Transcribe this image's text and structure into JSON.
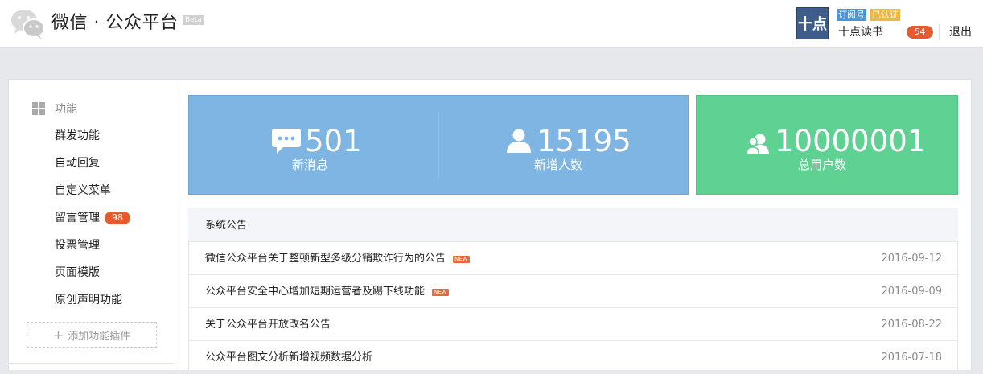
{
  "header": {
    "brand": "微信 · 公众平台",
    "beta": "Beta",
    "account": {
      "avatar_text": "十点",
      "type_tag": "订阅号",
      "verified_tag": "已认证",
      "name": "十点读书",
      "notice_count": "54",
      "logout": "退出"
    }
  },
  "sidebar": {
    "title": "功能",
    "items": [
      {
        "label": "群发功能"
      },
      {
        "label": "自动回复"
      },
      {
        "label": "自定义菜单"
      },
      {
        "label": "留言管理",
        "badge": "98"
      },
      {
        "label": "投票管理"
      },
      {
        "label": "页面模版"
      },
      {
        "label": "原创声明功能"
      }
    ],
    "add_plugin": "添加功能插件"
  },
  "stats": {
    "messages": {
      "value": "501",
      "label": "新消息"
    },
    "new_users": {
      "value": "15195",
      "label": "新增人数"
    },
    "total_users": {
      "value": "10000001",
      "label": "总用户数"
    }
  },
  "announcements": {
    "title": "系统公告",
    "new_tag": "NEW",
    "items": [
      {
        "text": "微信公众平台关于整顿新型多级分销欺诈行为的公告",
        "date": "2016-09-12",
        "is_new": true
      },
      {
        "text": "公众平台安全中心增加短期运营者及踢下线功能",
        "date": "2016-09-09",
        "is_new": true
      },
      {
        "text": "关于公众平台开放改名公告",
        "date": "2016-08-22",
        "is_new": false
      },
      {
        "text": "公众平台图文分析新增视频数据分析",
        "date": "2016-07-18",
        "is_new": false
      }
    ]
  },
  "colors": {
    "blue_panel": "#7eb5e2",
    "green_panel": "#5fd192",
    "badge_red": "#e65b2d",
    "type_tag_blue": "#4b96d8",
    "verified_orange": "#f0b83c"
  },
  "icons": [
    "wechat-logo-icon",
    "grid-icon",
    "plus-icon",
    "chat-bubble-icon",
    "person-icon",
    "users-icon"
  ]
}
